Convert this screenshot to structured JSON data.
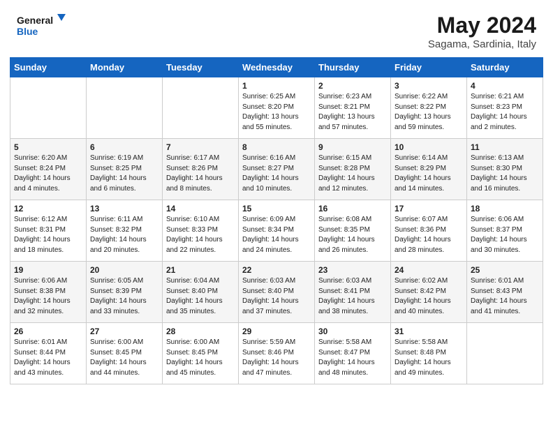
{
  "header": {
    "logo_line1": "General",
    "logo_line2": "Blue",
    "main_title": "May 2024",
    "sub_title": "Sagama, Sardinia, Italy"
  },
  "weekdays": [
    "Sunday",
    "Monday",
    "Tuesday",
    "Wednesday",
    "Thursday",
    "Friday",
    "Saturday"
  ],
  "weeks": [
    [
      {
        "num": "",
        "text": ""
      },
      {
        "num": "",
        "text": ""
      },
      {
        "num": "",
        "text": ""
      },
      {
        "num": "1",
        "text": "Sunrise: 6:25 AM\nSunset: 8:20 PM\nDaylight: 13 hours\nand 55 minutes."
      },
      {
        "num": "2",
        "text": "Sunrise: 6:23 AM\nSunset: 8:21 PM\nDaylight: 13 hours\nand 57 minutes."
      },
      {
        "num": "3",
        "text": "Sunrise: 6:22 AM\nSunset: 8:22 PM\nDaylight: 13 hours\nand 59 minutes."
      },
      {
        "num": "4",
        "text": "Sunrise: 6:21 AM\nSunset: 8:23 PM\nDaylight: 14 hours\nand 2 minutes."
      }
    ],
    [
      {
        "num": "5",
        "text": "Sunrise: 6:20 AM\nSunset: 8:24 PM\nDaylight: 14 hours\nand 4 minutes."
      },
      {
        "num": "6",
        "text": "Sunrise: 6:19 AM\nSunset: 8:25 PM\nDaylight: 14 hours\nand 6 minutes."
      },
      {
        "num": "7",
        "text": "Sunrise: 6:17 AM\nSunset: 8:26 PM\nDaylight: 14 hours\nand 8 minutes."
      },
      {
        "num": "8",
        "text": "Sunrise: 6:16 AM\nSunset: 8:27 PM\nDaylight: 14 hours\nand 10 minutes."
      },
      {
        "num": "9",
        "text": "Sunrise: 6:15 AM\nSunset: 8:28 PM\nDaylight: 14 hours\nand 12 minutes."
      },
      {
        "num": "10",
        "text": "Sunrise: 6:14 AM\nSunset: 8:29 PM\nDaylight: 14 hours\nand 14 minutes."
      },
      {
        "num": "11",
        "text": "Sunrise: 6:13 AM\nSunset: 8:30 PM\nDaylight: 14 hours\nand 16 minutes."
      }
    ],
    [
      {
        "num": "12",
        "text": "Sunrise: 6:12 AM\nSunset: 8:31 PM\nDaylight: 14 hours\nand 18 minutes."
      },
      {
        "num": "13",
        "text": "Sunrise: 6:11 AM\nSunset: 8:32 PM\nDaylight: 14 hours\nand 20 minutes."
      },
      {
        "num": "14",
        "text": "Sunrise: 6:10 AM\nSunset: 8:33 PM\nDaylight: 14 hours\nand 22 minutes."
      },
      {
        "num": "15",
        "text": "Sunrise: 6:09 AM\nSunset: 8:34 PM\nDaylight: 14 hours\nand 24 minutes."
      },
      {
        "num": "16",
        "text": "Sunrise: 6:08 AM\nSunset: 8:35 PM\nDaylight: 14 hours\nand 26 minutes."
      },
      {
        "num": "17",
        "text": "Sunrise: 6:07 AM\nSunset: 8:36 PM\nDaylight: 14 hours\nand 28 minutes."
      },
      {
        "num": "18",
        "text": "Sunrise: 6:06 AM\nSunset: 8:37 PM\nDaylight: 14 hours\nand 30 minutes."
      }
    ],
    [
      {
        "num": "19",
        "text": "Sunrise: 6:06 AM\nSunset: 8:38 PM\nDaylight: 14 hours\nand 32 minutes."
      },
      {
        "num": "20",
        "text": "Sunrise: 6:05 AM\nSunset: 8:39 PM\nDaylight: 14 hours\nand 33 minutes."
      },
      {
        "num": "21",
        "text": "Sunrise: 6:04 AM\nSunset: 8:40 PM\nDaylight: 14 hours\nand 35 minutes."
      },
      {
        "num": "22",
        "text": "Sunrise: 6:03 AM\nSunset: 8:40 PM\nDaylight: 14 hours\nand 37 minutes."
      },
      {
        "num": "23",
        "text": "Sunrise: 6:03 AM\nSunset: 8:41 PM\nDaylight: 14 hours\nand 38 minutes."
      },
      {
        "num": "24",
        "text": "Sunrise: 6:02 AM\nSunset: 8:42 PM\nDaylight: 14 hours\nand 40 minutes."
      },
      {
        "num": "25",
        "text": "Sunrise: 6:01 AM\nSunset: 8:43 PM\nDaylight: 14 hours\nand 41 minutes."
      }
    ],
    [
      {
        "num": "26",
        "text": "Sunrise: 6:01 AM\nSunset: 8:44 PM\nDaylight: 14 hours\nand 43 minutes."
      },
      {
        "num": "27",
        "text": "Sunrise: 6:00 AM\nSunset: 8:45 PM\nDaylight: 14 hours\nand 44 minutes."
      },
      {
        "num": "28",
        "text": "Sunrise: 6:00 AM\nSunset: 8:45 PM\nDaylight: 14 hours\nand 45 minutes."
      },
      {
        "num": "29",
        "text": "Sunrise: 5:59 AM\nSunset: 8:46 PM\nDaylight: 14 hours\nand 47 minutes."
      },
      {
        "num": "30",
        "text": "Sunrise: 5:58 AM\nSunset: 8:47 PM\nDaylight: 14 hours\nand 48 minutes."
      },
      {
        "num": "31",
        "text": "Sunrise: 5:58 AM\nSunset: 8:48 PM\nDaylight: 14 hours\nand 49 minutes."
      },
      {
        "num": "",
        "text": ""
      }
    ]
  ]
}
